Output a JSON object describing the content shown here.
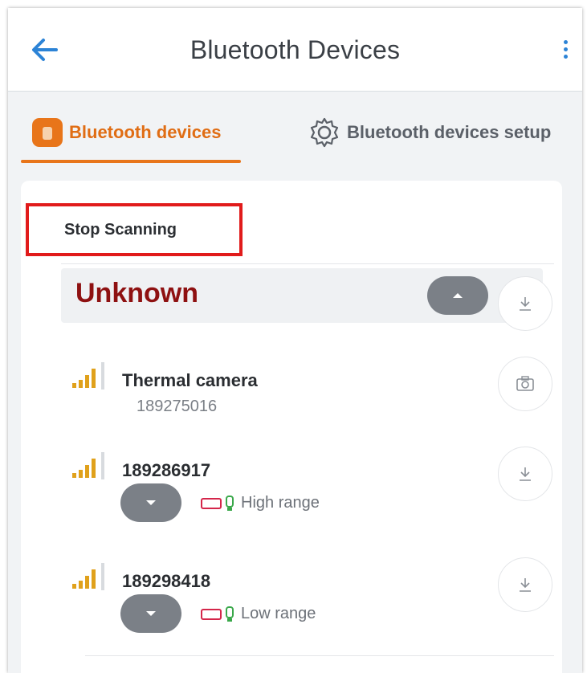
{
  "app": {
    "title": "Bluetooth Devices",
    "back_icon": "arrow-left-icon",
    "menu_icon": "more-vertical-icon",
    "accent": "#2c83d6"
  },
  "tabs": [
    {
      "label": "Bluetooth devices",
      "icon": "device-icon",
      "active": true,
      "color": "#e06d14"
    },
    {
      "label": "Bluetooth devices setup",
      "icon": "gear-icon",
      "active": false
    }
  ],
  "scan": {
    "label": "Stop Scanning"
  },
  "group": {
    "title": "Unknown",
    "title_color": "#8e1111",
    "collapse_icon": "chevron-up-icon",
    "download_icon": "download-icon"
  },
  "devices": [
    {
      "name": "Thermal camera",
      "id": "189275016",
      "signal_icon": "signal-bars-icon",
      "action_icon": "camera-icon"
    },
    {
      "name": "189286917",
      "range": "High range",
      "battery_icon": "battery-icon",
      "bulb_icon": "bulb-icon",
      "expand_icon": "chevron-down-icon",
      "action_icon": "download-icon"
    },
    {
      "name": "189298418",
      "range": "Low range",
      "battery_icon": "battery-icon",
      "bulb_icon": "bulb-icon",
      "expand_icon": "chevron-down-icon",
      "action_icon": "download-icon"
    }
  ]
}
